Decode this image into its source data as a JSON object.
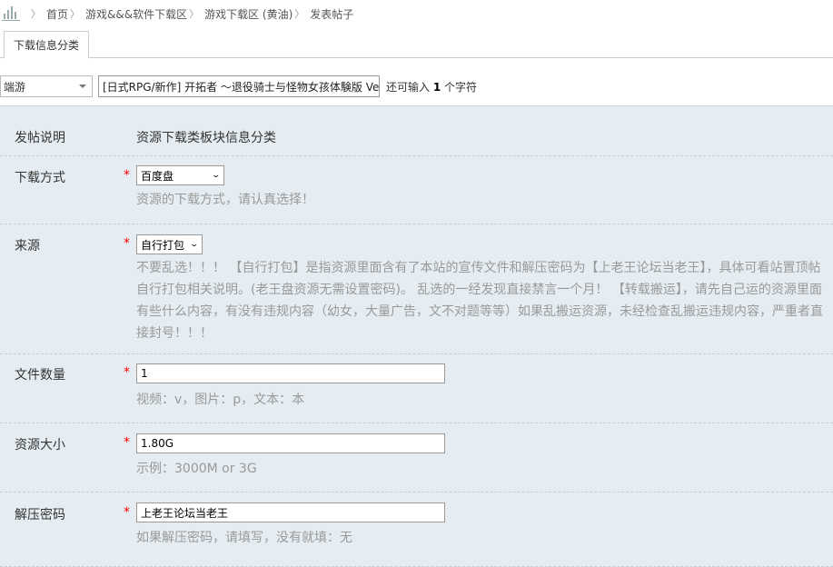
{
  "breadcrumb": {
    "items": [
      "首页",
      "游戏&&&软件下载区",
      "游戏下载区 (黄油)",
      "发表帖子"
    ]
  },
  "tab": {
    "label": "下载信息分类"
  },
  "title_row": {
    "type_select": "端游",
    "title_value": "[日式RPG/新作] 开拓者 ～退役骑士与怪物女孩体験版 Ve",
    "remain_prefix": "还可输入",
    "remain_count": "1",
    "remain_suffix": "个字符"
  },
  "form": {
    "intro": {
      "label": "发帖说明",
      "text": "资源下载类板块信息分类"
    },
    "download_method": {
      "label": "下载方式",
      "required": "*",
      "value": "百度盘",
      "hint": "资源的下载方式，请认真选择！"
    },
    "source": {
      "label": "来源",
      "required": "*",
      "value": "自行打包",
      "hint": "不要乱选！！！ 【自行打包】是指资源里面含有了本站的宣传文件和解压密码为【上老王论坛当老王】，具体可看站置顶帖自行打包相关说明。(老王盘资源无需设置密码)。 乱选的一经发现直接禁言一个月！ 【转载搬运】，请先自己运的资源里面有些什么内容，有没有违规内容（幼女，大量广告，文不对题等等）如果乱搬运资源，未经检查乱搬运违规内容，严重者直接封号！！！"
    },
    "file_count": {
      "label": "文件数量",
      "required": "*",
      "value": "1",
      "hint": "视频：v，图片：p，文本：本"
    },
    "size": {
      "label": "资源大小",
      "required": "*",
      "value": "1.80G",
      "hint": "示例：3000M or 3G"
    },
    "password": {
      "label": "解压密码",
      "required": "*",
      "value": "上老王论坛当老王",
      "hint": "如果解压密码，请填写，没有就填：无"
    }
  },
  "colors": {
    "panel_bg": "#e5edf2",
    "required": "#ff0000",
    "hint": "#999999"
  }
}
